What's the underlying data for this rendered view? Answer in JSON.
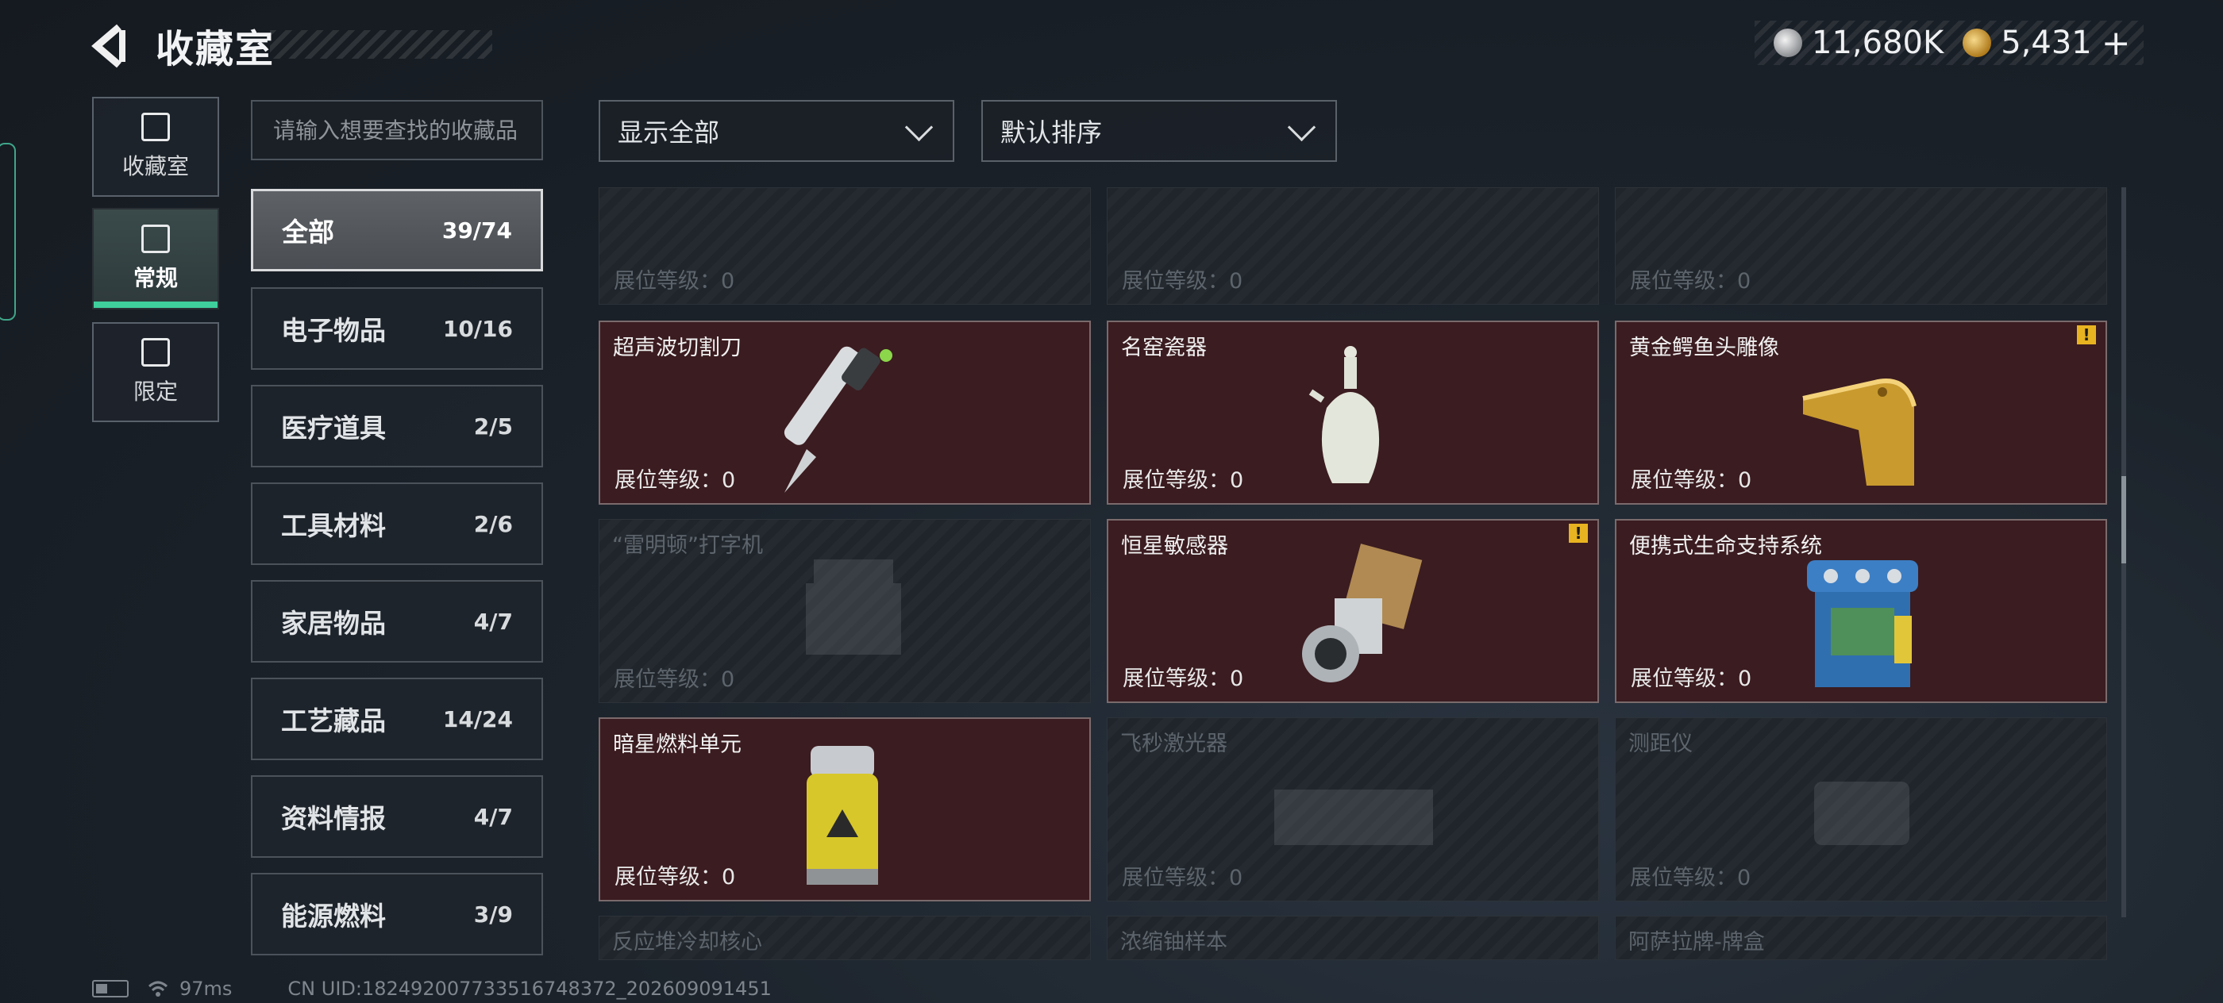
{
  "header": {
    "title": "收藏室",
    "currency_silver": "11,680K",
    "currency_gold": "5,431",
    "add_label": "+"
  },
  "nav_tabs": [
    {
      "label": "收藏室",
      "icon": "collection-room-icon",
      "active": false
    },
    {
      "label": "常规",
      "icon": "regular-icon",
      "active": true
    },
    {
      "label": "限定",
      "icon": "limited-icon",
      "active": false
    }
  ],
  "search": {
    "placeholder": "请输入想要查找的收藏品"
  },
  "categories": [
    {
      "name": "全部",
      "count": "39/74",
      "active": true
    },
    {
      "name": "电子物品",
      "count": "10/16"
    },
    {
      "name": "医疗道具",
      "count": "2/5"
    },
    {
      "name": "工具材料",
      "count": "2/6"
    },
    {
      "name": "家居物品",
      "count": "4/7"
    },
    {
      "name": "工艺藏品",
      "count": "14/24"
    },
    {
      "name": "资料情报",
      "count": "4/7"
    },
    {
      "name": "能源燃料",
      "count": "3/9"
    }
  ],
  "filters": {
    "show": "显示全部",
    "sort": "默认排序"
  },
  "level_label": "展位等级：",
  "items": [
    {
      "name": "",
      "level": "0",
      "owned": false,
      "icon": "unknown-item-icon"
    },
    {
      "name": "",
      "level": "0",
      "owned": false,
      "icon": "unknown-item-icon"
    },
    {
      "name": "",
      "level": "0",
      "owned": false,
      "icon": "unknown-item-icon"
    },
    {
      "name": "超声波切割刀",
      "level": "0",
      "owned": true,
      "icon": "ultrasonic-knife-icon"
    },
    {
      "name": "名窑瓷器",
      "level": "0",
      "owned": true,
      "icon": "porcelain-vase-icon"
    },
    {
      "name": "黄金鳄鱼头雕像",
      "level": "0",
      "owned": true,
      "alert": "!",
      "icon": "golden-crocodile-icon"
    },
    {
      "name": "“雷明顿”打字机",
      "level": "0",
      "owned": false,
      "icon": "typewriter-icon"
    },
    {
      "name": "恒星敏感器",
      "level": "0",
      "owned": true,
      "alert": "!",
      "icon": "star-sensor-icon"
    },
    {
      "name": "便携式生命支持系统",
      "level": "0",
      "owned": true,
      "icon": "life-support-icon"
    },
    {
      "name": "暗星燃料单元",
      "level": "0",
      "owned": true,
      "icon": "fuel-cell-icon"
    },
    {
      "name": "飞秒激光器",
      "level": "0",
      "owned": false,
      "icon": "laser-icon"
    },
    {
      "name": "测距仪",
      "level": "0",
      "owned": false,
      "icon": "rangefinder-icon"
    },
    {
      "name": "反应堆冷却核心",
      "owned": false,
      "icon": "reactor-core-icon"
    },
    {
      "name": "浓缩铀样本",
      "owned": false,
      "icon": "uranium-icon"
    },
    {
      "name": "阿萨拉牌-牌盒",
      "owned": false,
      "icon": "card-box-icon"
    }
  ],
  "status": {
    "ping": "97ms",
    "uid": "CN UID:18249200773351674837​2_202609091451"
  }
}
